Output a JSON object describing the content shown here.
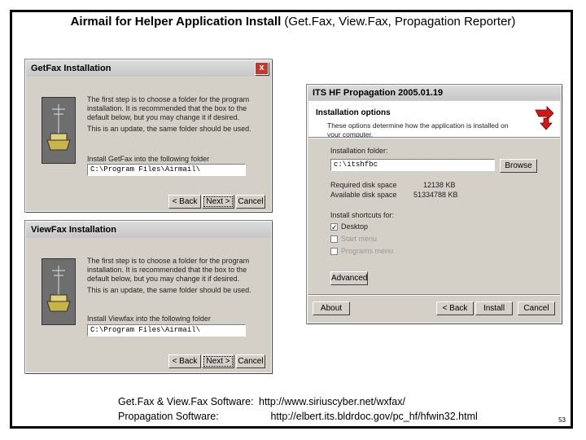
{
  "slide": {
    "title_bold": "Airmail for Helper Application Install",
    "title_rest": " (Get.Fax, View.Fax, Propagation Reporter)",
    "footer_line1_label": "Get.Fax & View.Fax Software:",
    "footer_line1_url": "http://www.siriuscyber.net/wxfax/",
    "footer_line2_label": "Propagation Software:",
    "footer_line2_url": "http://elbert.its.bldrdoc.gov/pc_hf/hfwin32.html",
    "page_number": "53"
  },
  "getfax": {
    "title": "GetFax Installation",
    "close": "x",
    "intro": "The first step is to choose a folder for the program installation. It is recommended that the box to the default below, but you may change it if desired.",
    "update_note": "This is an update, the same folder should be used.",
    "folder_label": "Install GetFax into the following folder",
    "folder_value": "C:\\Program Files\\Airmail\\",
    "back": "< Back",
    "next": "Next >",
    "cancel": "Cancel"
  },
  "viewfax": {
    "title": "ViewFax Installation",
    "close": "x",
    "intro": "The first step is to choose a folder for the program installation. It is recommended that the box to the default below, but you may change it if desired.",
    "update_note": "This is an update, the same folder should be used.",
    "folder_label": "Install Viewfax into the following folder",
    "folder_value": "C:\\Program Files\\Airmail\\",
    "back": "< Back",
    "next": "Next >",
    "cancel": "Cancel"
  },
  "its": {
    "title": "ITS HF Propagation 2005.01.19",
    "heading": "Installation options",
    "subheading": "These options determine how the application is installed on your computer.",
    "folder_label": "Installation folder:",
    "folder_value": "c:\\itshfbc",
    "browse": "Browse",
    "required_label": "Required disk space",
    "required_value": "12138 KB",
    "available_label": "Available disk space",
    "available_value": "51334788 KB",
    "shortcuts_label": "Install shortcuts for:",
    "desktop": "Desktop",
    "start_menu": "Start menu",
    "programs_menu": "Programs menu",
    "advanced": "Advanced",
    "about": "About",
    "back": "< Back",
    "install": "Install",
    "cancel": "Cancel"
  }
}
